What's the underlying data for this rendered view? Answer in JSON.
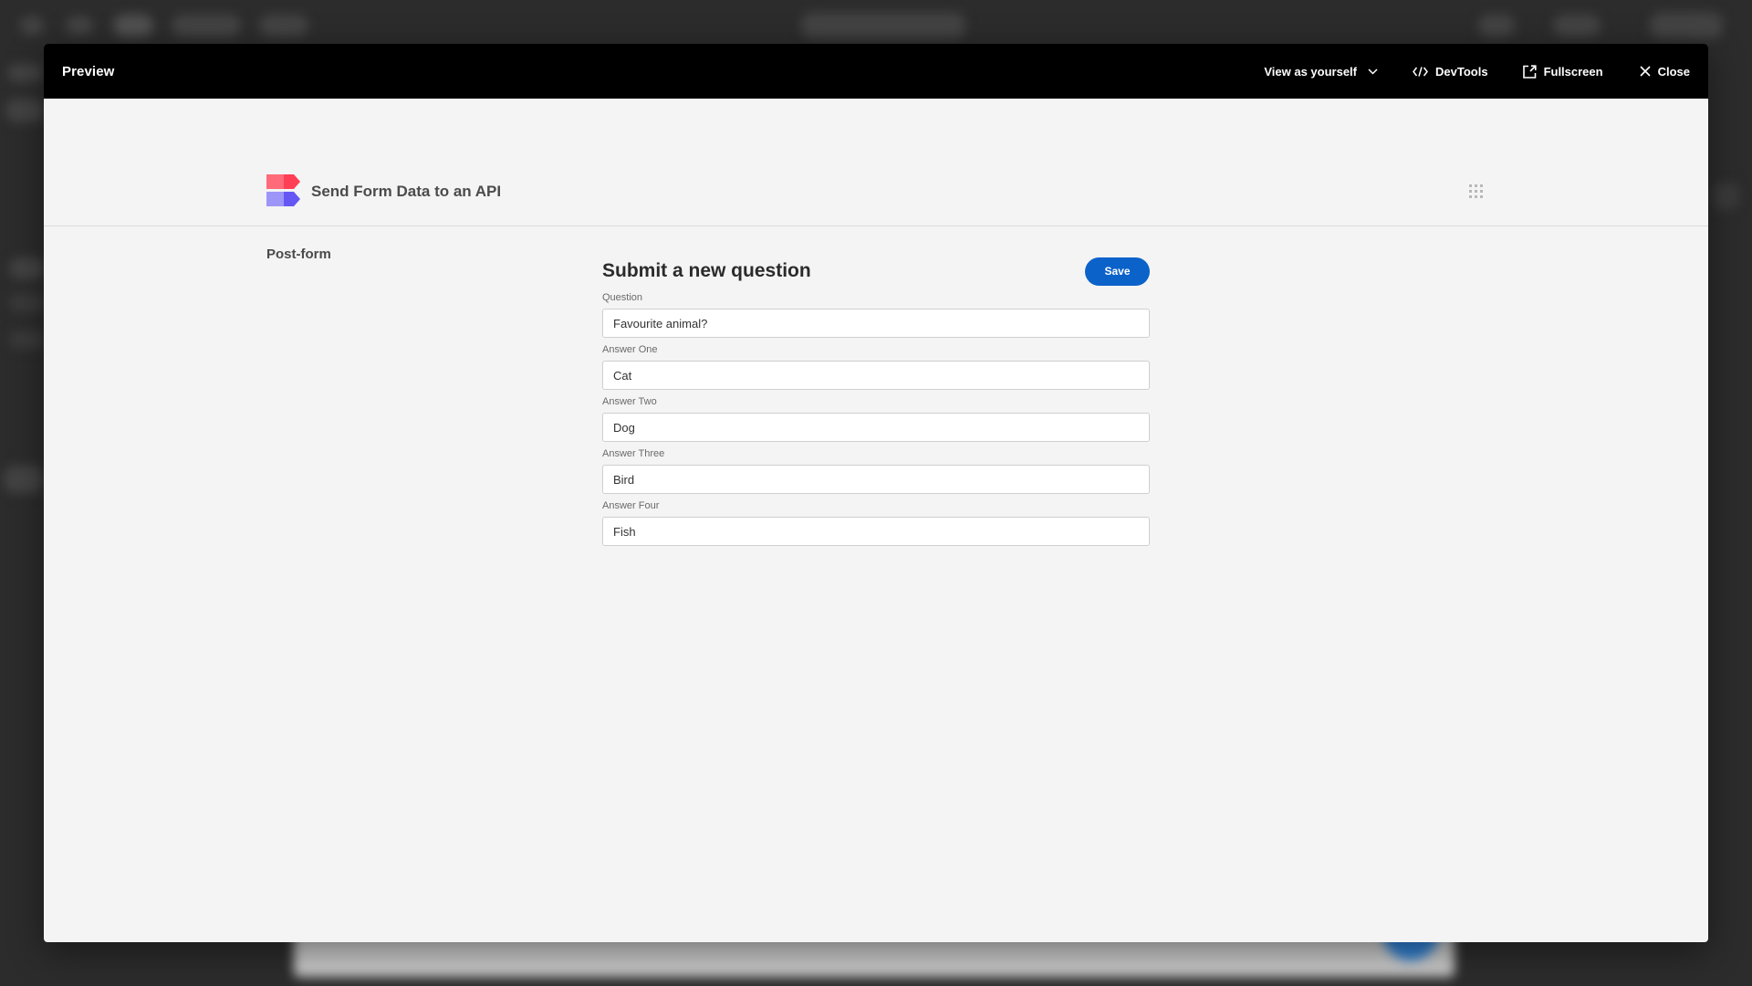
{
  "modal": {
    "title": "Preview",
    "actions": {
      "view_as": "View as yourself",
      "devtools": "DevTools",
      "fullscreen": "Fullscreen",
      "close": "Close"
    },
    "icons": {
      "view_as": "chevron-down-icon",
      "devtools": "code-icon",
      "fullscreen": "external-link-icon",
      "close": "close-icon"
    }
  },
  "app": {
    "title": "Send Form Data to an API",
    "logo": {
      "top_colors": [
        "#ff6b78",
        "#ff3f55"
      ],
      "bottom_colors": [
        "#9d96f8",
        "#6657f4"
      ]
    },
    "nav": {
      "link": "Post-form"
    },
    "menu_icon": "grid-icon"
  },
  "form": {
    "title": "Submit a new question",
    "save_label": "Save",
    "accent": "#0b62c9",
    "fields": [
      {
        "label": "Question",
        "value": "Favourite animal?"
      },
      {
        "label": "Answer One",
        "value": "Cat"
      },
      {
        "label": "Answer Two",
        "value": "Dog"
      },
      {
        "label": "Answer Three",
        "value": "Bird"
      },
      {
        "label": "Answer Four",
        "value": "Fish"
      }
    ]
  }
}
